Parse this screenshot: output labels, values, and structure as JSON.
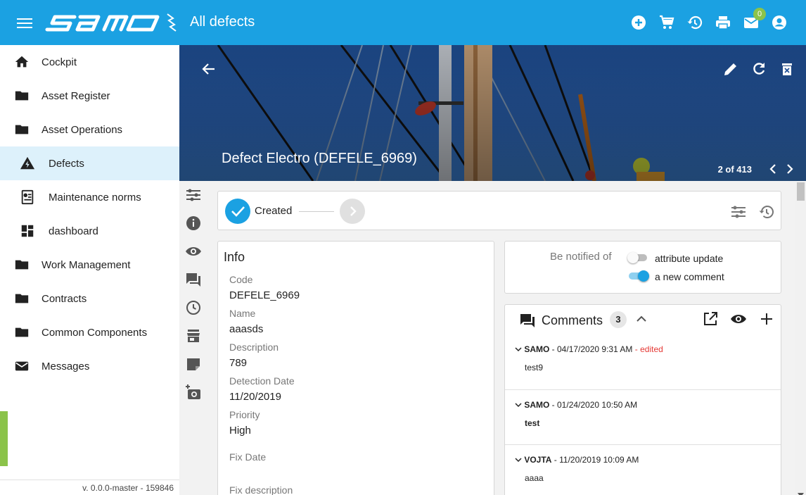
{
  "app": {
    "brand": "SAMO",
    "page_title": "All defects",
    "mail_badge": "0"
  },
  "topbar": {
    "icons": [
      "add-circle-icon",
      "cart-icon",
      "history-icon",
      "print-icon",
      "mail-icon",
      "account-icon"
    ]
  },
  "sidebar": {
    "items": [
      {
        "label": "Cockpit",
        "icon": "home-icon"
      },
      {
        "label": "Asset Register",
        "icon": "folder-icon"
      },
      {
        "label": "Asset Operations",
        "icon": "folder-icon"
      },
      {
        "label": "Defects",
        "icon": "warning-icon",
        "active": true
      },
      {
        "label": "Maintenance norms",
        "icon": "norms-icon"
      },
      {
        "label": "dashboard",
        "icon": "dashboard-icon"
      },
      {
        "label": "Work Management",
        "icon": "folder-icon"
      },
      {
        "label": "Contracts",
        "icon": "folder-icon"
      },
      {
        "label": "Common Components",
        "icon": "folder-icon"
      },
      {
        "label": "Messages",
        "icon": "mail-icon"
      }
    ],
    "version": "v. 0.0.0-master - 159846"
  },
  "banner": {
    "title": "Defect Electro (DEFELE_6969)",
    "pager": "2 of 413"
  },
  "workflow": {
    "current_step": "Created"
  },
  "info": {
    "heading": "Info",
    "fields": [
      {
        "label": "Code",
        "value": "DEFELE_6969"
      },
      {
        "label": "Name",
        "value": "aaasds"
      },
      {
        "label": "Description",
        "value": "789"
      },
      {
        "label": "Detection Date",
        "value": "11/20/2019"
      },
      {
        "label": "Priority",
        "value": "High"
      },
      {
        "label": "Fix Date",
        "value": ""
      },
      {
        "label": "Fix description",
        "value": ""
      }
    ]
  },
  "notify": {
    "label": "Be notified of",
    "options": [
      {
        "label": "attribute update",
        "on": false
      },
      {
        "label": "a new comment",
        "on": true
      }
    ]
  },
  "comments": {
    "title": "Comments",
    "count": "3",
    "items": [
      {
        "author": "SAMO",
        "date": " - 04/17/2020 9:31 AM",
        "edited": " - edited",
        "text": "test9",
        "bold": false
      },
      {
        "author": "SAMO",
        "date": " - 01/24/2020 10:50 AM",
        "edited": "",
        "text": "test",
        "bold": true
      },
      {
        "author": "VOJTA",
        "date": " - 11/20/2019 10:09 AM",
        "edited": "",
        "text": "aaaa",
        "bold": false
      }
    ]
  },
  "colors": {
    "primary": "#1ba1e2",
    "accent_green": "#8bc34a",
    "active_bg": "#ddf1fb",
    "edited": "#e53935"
  }
}
